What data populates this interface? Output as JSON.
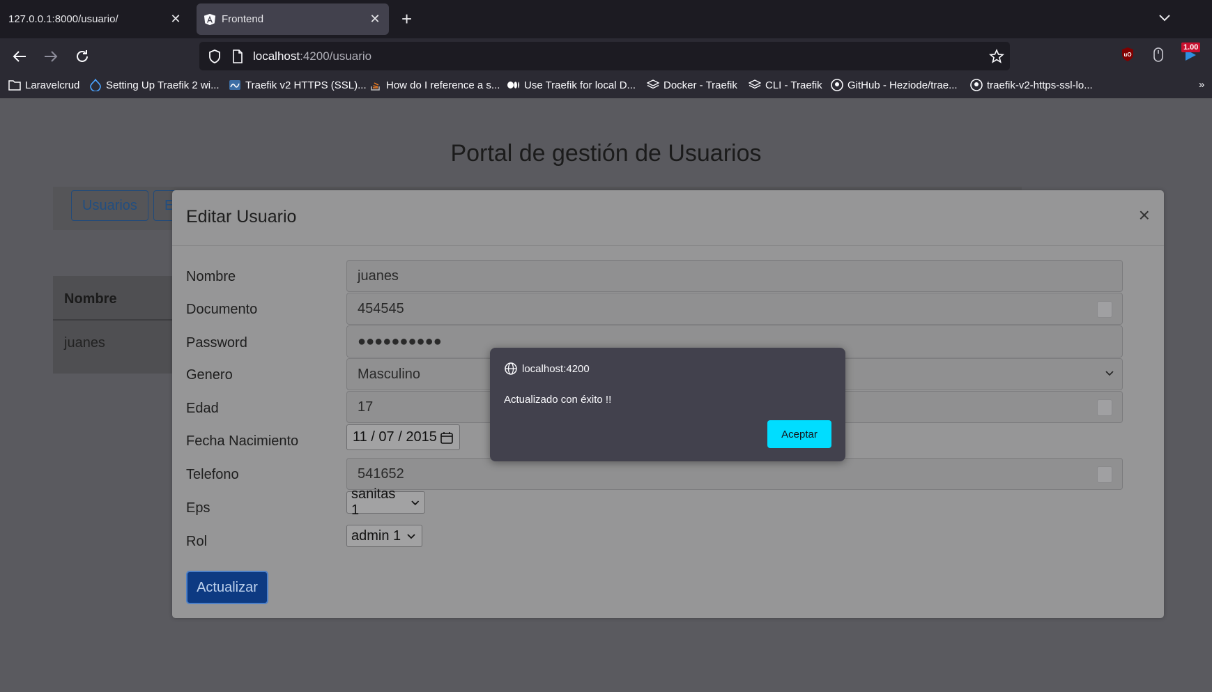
{
  "browser": {
    "tabs": [
      {
        "title": "127.0.0.1:8000/usuario/"
      },
      {
        "title": "Frontend"
      }
    ],
    "url": {
      "host": "localhost",
      "path": ":4200/usuario"
    },
    "badge": "1.00",
    "bookmarks": [
      "Laravelcrud",
      "Setting Up Traefik 2 wi...",
      "Traefik v2 HTTPS (SSL)...",
      "How do I reference a s...",
      "Use Traefik for local D...",
      "Docker - Traefik",
      "CLI - Traefik",
      "GitHub - Heziode/trae...",
      "traefik-v2-https-ssl-lo..."
    ]
  },
  "page": {
    "title": "Portal de gestión de Usuarios",
    "tabs": [
      "Usuarios",
      "E"
    ],
    "table": {
      "header": "Nombre",
      "rows": [
        "juanes"
      ]
    }
  },
  "modal": {
    "title": "Editar Usuario",
    "close": "×",
    "fields": {
      "nombre": {
        "label": "Nombre",
        "value": "juanes"
      },
      "documento": {
        "label": "Documento",
        "value": "454545"
      },
      "password": {
        "label": "Password",
        "value": "●●●●●●●●●●"
      },
      "genero": {
        "label": "Genero",
        "value": "Masculino"
      },
      "edad": {
        "label": "Edad",
        "value": "17"
      },
      "fecha": {
        "label": "Fecha Nacimiento",
        "value": "11 / 07 / 2015"
      },
      "telefono": {
        "label": "Telefono",
        "value": "541652"
      },
      "eps": {
        "label": "Eps",
        "value": "sanitas 1"
      },
      "rol": {
        "label": "Rol",
        "value": "admin 1"
      }
    },
    "submit": "Actualizar"
  },
  "alert": {
    "origin": "localhost:4200",
    "message": "Actualizado con éxito !!",
    "ok": "Aceptar"
  },
  "colors": {
    "accent": "#00ddff",
    "primary_button": "#0d3a82"
  }
}
